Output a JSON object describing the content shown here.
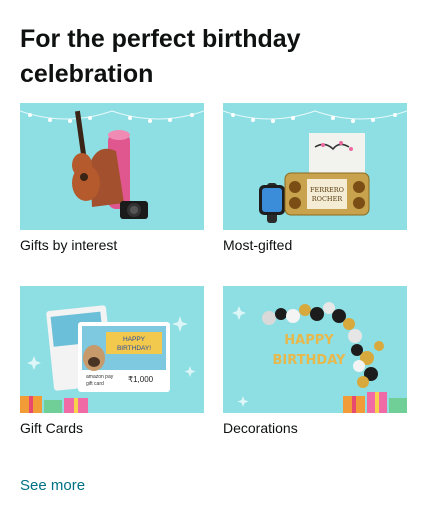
{
  "card": {
    "title": "For the perfect birthday celebration",
    "tiles": [
      {
        "label": "Gifts by interest",
        "image": "guitar-bag-camera-image"
      },
      {
        "label": "Most-gifted",
        "image": "watch-chocolates-image",
        "product_text": [
          "FERRERO",
          "ROCHER"
        ]
      },
      {
        "label": "Gift Cards",
        "image": "gift-card-image",
        "product_text": [
          "HAPPY",
          "BIRTHDAY!",
          "amazon pay",
          "gift card",
          "₹1,000"
        ]
      },
      {
        "label": "Decorations",
        "image": "balloon-decoration-image",
        "product_text": [
          "HAPPY",
          "BIRTHDAY"
        ]
      }
    ],
    "see_more": "See more"
  },
  "colors": {
    "tile_bg": "#8ddfe4",
    "link": "#007185",
    "text": "#0f1111"
  }
}
